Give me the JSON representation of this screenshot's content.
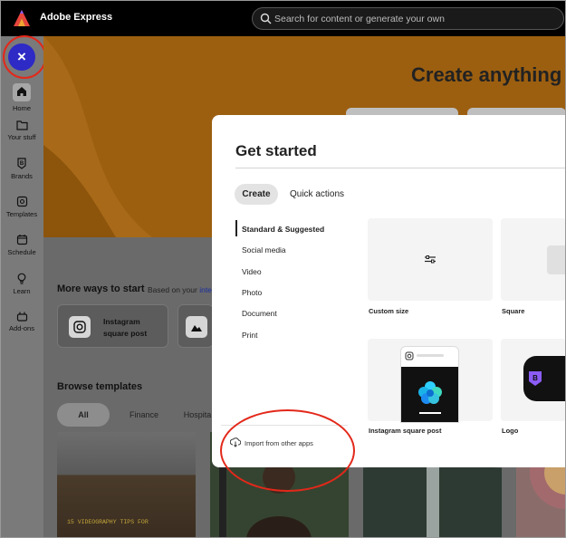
{
  "app": {
    "title": "Adobe Express"
  },
  "search": {
    "placeholder": "Search for content or generate your own"
  },
  "sidebar": {
    "close_label": "×",
    "items": [
      {
        "label": "Home",
        "icon": "home-icon"
      },
      {
        "label": "Your stuff",
        "icon": "folder-icon"
      },
      {
        "label": "Brands",
        "icon": "brand-icon"
      },
      {
        "label": "Templates",
        "icon": "templates-icon"
      },
      {
        "label": "Schedule",
        "icon": "calendar-icon"
      },
      {
        "label": "Learn",
        "icon": "lightbulb-icon"
      },
      {
        "label": "Add-ons",
        "icon": "addons-icon"
      }
    ]
  },
  "hero": {
    "title": "Create anything"
  },
  "more_ways": {
    "title": "More ways to start",
    "subtitle": "Based on your",
    "subtitle_link": "inter",
    "cards": [
      {
        "label": "Instagram square post",
        "icon": "instagram-icon"
      }
    ]
  },
  "browse": {
    "title": "Browse templates",
    "filters": [
      "All",
      "Finance",
      "Hospita"
    ],
    "thumb_text": "15 VIDEOGRAPHY TIPS FOR"
  },
  "modal": {
    "title": "Get started",
    "tabs": [
      "Create",
      "Quick actions"
    ],
    "categories": [
      "Standard & Suggested",
      "Social media",
      "Video",
      "Photo",
      "Document",
      "Print"
    ],
    "import_label": "Import from other apps",
    "tiles": [
      {
        "label": "Custom size",
        "icon": "sliders-icon"
      },
      {
        "label": "Square"
      },
      {
        "label": "Instagram square post"
      },
      {
        "label": "Logo"
      }
    ]
  },
  "colors": {
    "accent": "#2d2ac5",
    "annotation": "#e3281a",
    "hero": "#9c5f10"
  }
}
